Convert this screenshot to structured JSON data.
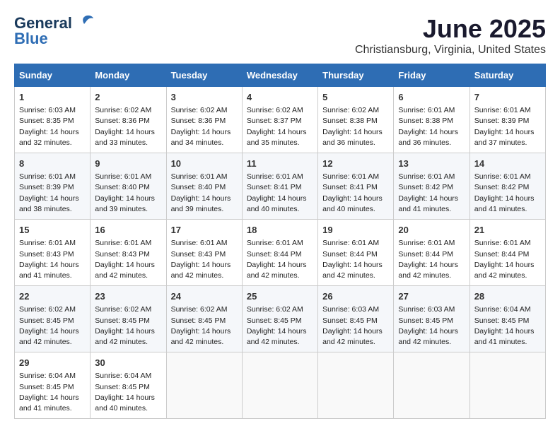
{
  "header": {
    "logo_line1": "General",
    "logo_line2": "Blue",
    "month": "June 2025",
    "location": "Christiansburg, Virginia, United States"
  },
  "weekdays": [
    "Sunday",
    "Monday",
    "Tuesday",
    "Wednesday",
    "Thursday",
    "Friday",
    "Saturday"
  ],
  "weeks": [
    [
      {
        "day": "1",
        "info": "Sunrise: 6:03 AM\nSunset: 8:35 PM\nDaylight: 14 hours\nand 32 minutes."
      },
      {
        "day": "2",
        "info": "Sunrise: 6:02 AM\nSunset: 8:36 PM\nDaylight: 14 hours\nand 33 minutes."
      },
      {
        "day": "3",
        "info": "Sunrise: 6:02 AM\nSunset: 8:36 PM\nDaylight: 14 hours\nand 34 minutes."
      },
      {
        "day": "4",
        "info": "Sunrise: 6:02 AM\nSunset: 8:37 PM\nDaylight: 14 hours\nand 35 minutes."
      },
      {
        "day": "5",
        "info": "Sunrise: 6:02 AM\nSunset: 8:38 PM\nDaylight: 14 hours\nand 36 minutes."
      },
      {
        "day": "6",
        "info": "Sunrise: 6:01 AM\nSunset: 8:38 PM\nDaylight: 14 hours\nand 36 minutes."
      },
      {
        "day": "7",
        "info": "Sunrise: 6:01 AM\nSunset: 8:39 PM\nDaylight: 14 hours\nand 37 minutes."
      }
    ],
    [
      {
        "day": "8",
        "info": "Sunrise: 6:01 AM\nSunset: 8:39 PM\nDaylight: 14 hours\nand 38 minutes."
      },
      {
        "day": "9",
        "info": "Sunrise: 6:01 AM\nSunset: 8:40 PM\nDaylight: 14 hours\nand 39 minutes."
      },
      {
        "day": "10",
        "info": "Sunrise: 6:01 AM\nSunset: 8:40 PM\nDaylight: 14 hours\nand 39 minutes."
      },
      {
        "day": "11",
        "info": "Sunrise: 6:01 AM\nSunset: 8:41 PM\nDaylight: 14 hours\nand 40 minutes."
      },
      {
        "day": "12",
        "info": "Sunrise: 6:01 AM\nSunset: 8:41 PM\nDaylight: 14 hours\nand 40 minutes."
      },
      {
        "day": "13",
        "info": "Sunrise: 6:01 AM\nSunset: 8:42 PM\nDaylight: 14 hours\nand 41 minutes."
      },
      {
        "day": "14",
        "info": "Sunrise: 6:01 AM\nSunset: 8:42 PM\nDaylight: 14 hours\nand 41 minutes."
      }
    ],
    [
      {
        "day": "15",
        "info": "Sunrise: 6:01 AM\nSunset: 8:43 PM\nDaylight: 14 hours\nand 41 minutes."
      },
      {
        "day": "16",
        "info": "Sunrise: 6:01 AM\nSunset: 8:43 PM\nDaylight: 14 hours\nand 42 minutes."
      },
      {
        "day": "17",
        "info": "Sunrise: 6:01 AM\nSunset: 8:43 PM\nDaylight: 14 hours\nand 42 minutes."
      },
      {
        "day": "18",
        "info": "Sunrise: 6:01 AM\nSunset: 8:44 PM\nDaylight: 14 hours\nand 42 minutes."
      },
      {
        "day": "19",
        "info": "Sunrise: 6:01 AM\nSunset: 8:44 PM\nDaylight: 14 hours\nand 42 minutes."
      },
      {
        "day": "20",
        "info": "Sunrise: 6:01 AM\nSunset: 8:44 PM\nDaylight: 14 hours\nand 42 minutes."
      },
      {
        "day": "21",
        "info": "Sunrise: 6:01 AM\nSunset: 8:44 PM\nDaylight: 14 hours\nand 42 minutes."
      }
    ],
    [
      {
        "day": "22",
        "info": "Sunrise: 6:02 AM\nSunset: 8:45 PM\nDaylight: 14 hours\nand 42 minutes."
      },
      {
        "day": "23",
        "info": "Sunrise: 6:02 AM\nSunset: 8:45 PM\nDaylight: 14 hours\nand 42 minutes."
      },
      {
        "day": "24",
        "info": "Sunrise: 6:02 AM\nSunset: 8:45 PM\nDaylight: 14 hours\nand 42 minutes."
      },
      {
        "day": "25",
        "info": "Sunrise: 6:02 AM\nSunset: 8:45 PM\nDaylight: 14 hours\nand 42 minutes."
      },
      {
        "day": "26",
        "info": "Sunrise: 6:03 AM\nSunset: 8:45 PM\nDaylight: 14 hours\nand 42 minutes."
      },
      {
        "day": "27",
        "info": "Sunrise: 6:03 AM\nSunset: 8:45 PM\nDaylight: 14 hours\nand 42 minutes."
      },
      {
        "day": "28",
        "info": "Sunrise: 6:04 AM\nSunset: 8:45 PM\nDaylight: 14 hours\nand 41 minutes."
      }
    ],
    [
      {
        "day": "29",
        "info": "Sunrise: 6:04 AM\nSunset: 8:45 PM\nDaylight: 14 hours\nand 41 minutes."
      },
      {
        "day": "30",
        "info": "Sunrise: 6:04 AM\nSunset: 8:45 PM\nDaylight: 14 hours\nand 40 minutes."
      },
      {
        "day": "",
        "info": ""
      },
      {
        "day": "",
        "info": ""
      },
      {
        "day": "",
        "info": ""
      },
      {
        "day": "",
        "info": ""
      },
      {
        "day": "",
        "info": ""
      }
    ]
  ]
}
